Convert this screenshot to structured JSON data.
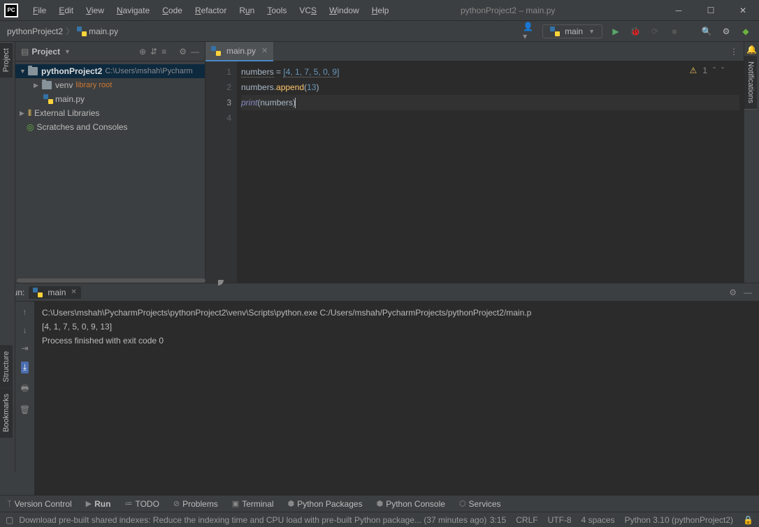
{
  "window": {
    "title": "pythonProject2 – main.py"
  },
  "menu": [
    "File",
    "Edit",
    "View",
    "Navigate",
    "Code",
    "Refactor",
    "Run",
    "Tools",
    "VCS",
    "Window",
    "Help"
  ],
  "breadcrumb": {
    "project": "pythonProject2",
    "file": "main.py"
  },
  "runConfig": {
    "name": "main"
  },
  "projectPanel": {
    "title": "Project",
    "root": {
      "name": "pythonProject2",
      "path": "C:\\Users\\mshah\\Pycharm"
    },
    "venv": {
      "name": "venv",
      "hint": "library root"
    },
    "file": {
      "name": "main.py"
    },
    "extLib": "External Libraries",
    "scratches": "Scratches and Consoles"
  },
  "editor": {
    "tab": "main.py",
    "lines": {
      "l1": {
        "var": "numbers",
        "op": " = ",
        "rest": "[4, 1, 7, 5, 0, 9]"
      },
      "l2": {
        "obj": "numbers",
        "dot": ".",
        "fn": "append",
        "open": "(",
        "arg": "13",
        "close": ")"
      },
      "l3": {
        "fn": "print",
        "open": "(",
        "arg": "numbers",
        "close": ")"
      }
    },
    "inspection": {
      "warnings": "1"
    }
  },
  "run": {
    "label": "Run:",
    "tab": "main",
    "out1": "C:\\Users\\mshah\\PycharmProjects\\pythonProject2\\venv\\Scripts\\python.exe C:/Users/mshah/PycharmProjects/pythonProject2/main.p",
    "out2": "[4, 1, 7, 5, 0, 9, 13]",
    "out3": "",
    "out4": "Process finished with exit code 0"
  },
  "bottomTabs": {
    "vcs": "Version Control",
    "run": "Run",
    "todo": "TODO",
    "problems": "Problems",
    "terminal": "Terminal",
    "pkg": "Python Packages",
    "console": "Python Console",
    "services": "Services"
  },
  "sideLabels": {
    "project": "Project",
    "structure": "Structure",
    "bookmarks": "Bookmarks",
    "notifications": "Notifications"
  },
  "status": {
    "msg": "Download pre-built shared indexes: Reduce the indexing time and CPU load with pre-built Python package... (37 minutes ago)",
    "pos": "3:15",
    "eol": "CRLF",
    "enc": "UTF-8",
    "indent": "4 spaces",
    "sdk": "Python 3.10 (pythonProject2)"
  }
}
